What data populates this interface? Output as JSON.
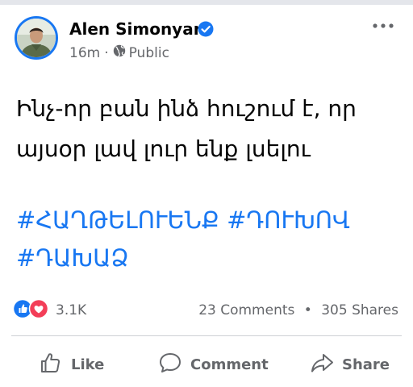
{
  "post": {
    "author": "Alen Simonyan",
    "time": "16m",
    "separator": "·",
    "audience": "Public",
    "text_line1": "Ինչ-որ բան ինձ հուշում է, որ",
    "text_line2": "այսօր լավ լուր ենք լսելու",
    "hashtags": [
      "#ՀԱՂԹԵԼՈՒԵՆՔ",
      "#ԴՈՒԽՈՎ",
      "#ԴԱԽԱՁ"
    ]
  },
  "stats": {
    "reaction_count": "3.1K",
    "comments": "23 Comments",
    "dot": "•",
    "shares": "305 Shares"
  },
  "actions": {
    "like": "Like",
    "comment": "Comment",
    "share": "Share"
  },
  "colors": {
    "accent": "#1877f2",
    "love": "#f33e58",
    "secondary_text": "#65676b"
  },
  "icons": [
    "verified-badge-icon",
    "globe-icon",
    "more-options-icon",
    "like-reaction-icon",
    "love-reaction-icon",
    "thumbs-up-icon",
    "comment-bubble-icon",
    "share-arrow-icon"
  ]
}
